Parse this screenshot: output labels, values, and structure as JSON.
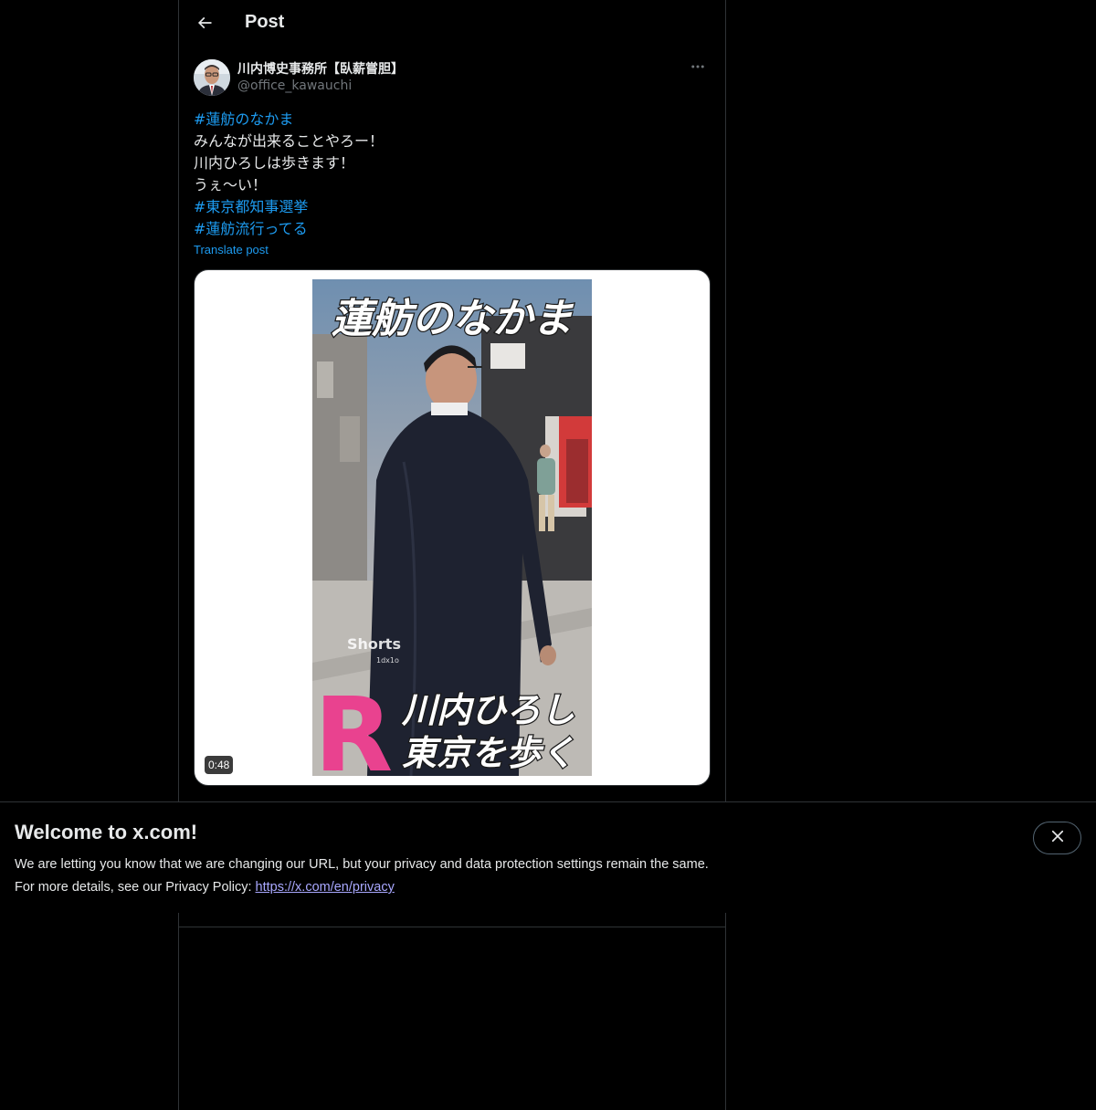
{
  "header": {
    "title": "Post"
  },
  "post": {
    "author_name": "川内博史事務所【臥薪嘗胆】",
    "author_handle": "@office_kawauchi",
    "lines": [
      {
        "text": "#蓮舫のなかま",
        "hashtag": true
      },
      {
        "text": "みんなが出来ることやろー！",
        "hashtag": false
      },
      {
        "text": "川内ひろしは歩きます！",
        "hashtag": false
      },
      {
        "text": "うぇ〜い！",
        "hashtag": false
      },
      {
        "text": "#東京都知事選挙",
        "hashtag": true
      },
      {
        "text": "#蓮舫流行ってる",
        "hashtag": true
      }
    ],
    "translate_label": "Translate post",
    "video": {
      "duration": "0:48",
      "caption_top": "蓮舫のなかま",
      "caption_bottom_line1": "川内ひろし",
      "caption_bottom_line2": "東京を歩く",
      "badge_letter": "R",
      "watermark": "Shorts",
      "watermark_sub": "1dx1o"
    }
  },
  "banner": {
    "title": "Welcome to x.com!",
    "line1": "We are letting you know that we are changing our URL, but your privacy and data protection settings remain the same.",
    "line2_prefix": "For more details, see our Privacy Policy: ",
    "link_text": "https://x.com/en/privacy"
  },
  "icons": {
    "back": "arrow-left-icon",
    "more": "more-horizontal-icon",
    "close": "close-icon"
  },
  "colors": {
    "background": "#000000",
    "text": "#e7e9ea",
    "secondary_text": "#71767b",
    "accent": "#1d9bf0",
    "border": "#2f3336",
    "link_visited": "#a9a8ff",
    "video_badge_pink": "#e9428f"
  }
}
